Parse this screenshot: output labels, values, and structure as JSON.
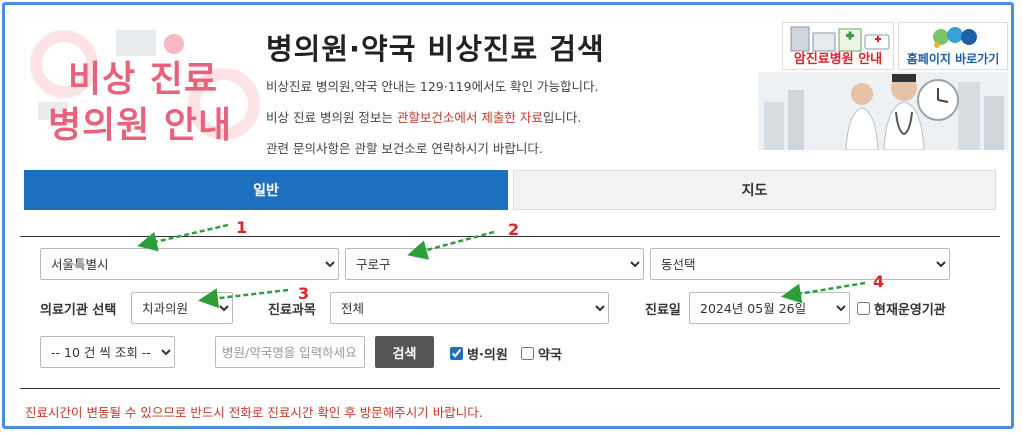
{
  "header": {
    "hero_line1": "비상 진료",
    "hero_line2": "병의원 안내",
    "title": "병의원·약국 비상진료 검색",
    "desc1": "비상진료 병의원,약국 안내는 129·119에서도 확인 가능합니다.",
    "desc2_pre": "비상 진료 병의원 정보는 ",
    "desc2_highlight": "관할보건소에서 제출한 자료",
    "desc2_post": "입니다.",
    "desc3": "관련 문의사항은 관할 보건소로 연락하시기 바랍니다."
  },
  "banners": {
    "cancer_label": "암진료병원 안내",
    "home_label": "홈페이지 바로가기"
  },
  "tabs": {
    "general": "일반",
    "map": "지도"
  },
  "filters": {
    "sido": "서울특별시",
    "sigungu": "구로구",
    "dong": "동선택",
    "institution_label": "의료기관 선택",
    "institution": "치과의원",
    "department_label": "진료과목",
    "department": "전체",
    "date_label": "진료일",
    "date": "2024년 05월 26일",
    "operating_only": "현재운영기관",
    "page_size": "-- 10 건 씩 조회 --",
    "name_placeholder": "병원/약국명을 입력하세요",
    "search_button": "검색",
    "hospital_check": "병·의원",
    "pharmacy_check": "약국"
  },
  "notice": "진료시간이 변동될 수 있으므로 반드시 전화로 진료시간 확인 후 방문해주시기 바랍니다.",
  "annotations": [
    "1",
    "2",
    "3",
    "4"
  ],
  "colors": {
    "accent": "#1d6fbf",
    "hero_pink": "#e8627b",
    "highlight_red": "#c0392b",
    "arrow_green": "#2e9e3b",
    "annotation_red": "#d9252b"
  }
}
